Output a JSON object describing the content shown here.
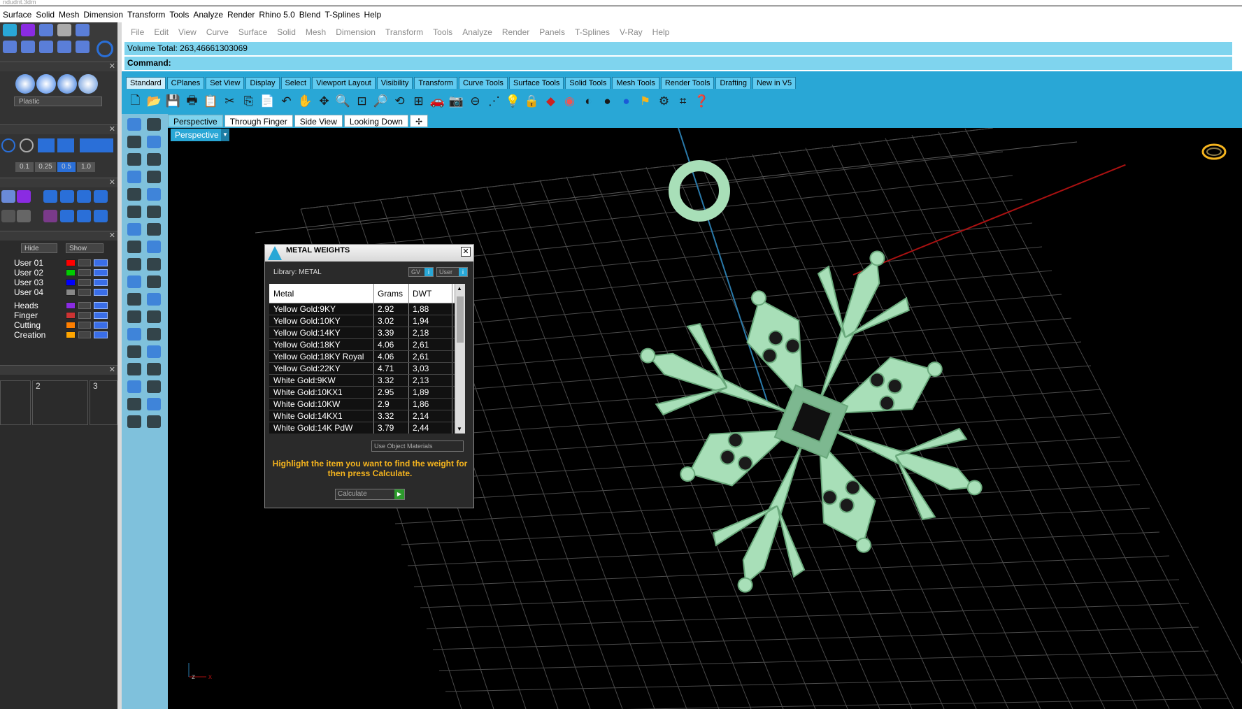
{
  "titlebar": {
    "text": "ndudnt.3dm"
  },
  "menubar": [
    "Surface",
    "Solid",
    "Mesh",
    "Dimension",
    "Transform",
    "Tools",
    "Analyze",
    "Render",
    "Rhino 5.0",
    "Blend",
    "T-Splines",
    "Help"
  ],
  "rhino_menu": [
    "File",
    "Edit",
    "View",
    "Curve",
    "Surface",
    "Solid",
    "Mesh",
    "Dimension",
    "Transform",
    "Tools",
    "Analyze",
    "Render",
    "Panels",
    "T-Splines",
    "V-Ray",
    "Help"
  ],
  "command": {
    "history": "Volume Total: 263,46661303069",
    "prompt": "Command:"
  },
  "toolbar_tabs": [
    "Standard",
    "CPlanes",
    "Set View",
    "Display",
    "Select",
    "Viewport Layout",
    "Visibility",
    "Transform",
    "Curve Tools",
    "Surface Tools",
    "Solid Tools",
    "Mesh Tools",
    "Render Tools",
    "Drafting",
    "New in V5"
  ],
  "view_tabs": [
    "Perspective",
    "Through Finger",
    "Side View",
    "Looking Down"
  ],
  "viewport": {
    "label": "Perspective"
  },
  "left_panel": {
    "material": "Plastic",
    "snaps": [
      "0.1",
      "0.25",
      "0.5",
      "1.0"
    ],
    "hide_label": "Hide",
    "show_label": "Show",
    "layers": [
      {
        "name": "User 01",
        "color": "#ff0000"
      },
      {
        "name": "User 02",
        "color": "#00cc00"
      },
      {
        "name": "User 03",
        "color": "#0000ff"
      },
      {
        "name": "User 04",
        "color": "#888888"
      },
      {
        "name": "Heads",
        "color": "#8a2be2"
      },
      {
        "name": "Finger",
        "color": "#cc3333"
      },
      {
        "name": "Cutting",
        "color": "#ff7f00"
      },
      {
        "name": "Creation",
        "color": "#ffa500"
      }
    ],
    "columns": [
      "2",
      "3"
    ]
  },
  "metal_weights": {
    "title": "METAL WEIGHTS",
    "library": "Library: METAL",
    "gv_label": "GV",
    "user_label": "User",
    "headers": [
      "Metal",
      "Grams",
      "DWT"
    ],
    "rows": [
      [
        "Yellow Gold:9KY",
        "2.92",
        "1,88"
      ],
      [
        "Yellow Gold:10KY",
        "3.02",
        "1,94"
      ],
      [
        "Yellow Gold:14KY",
        "3.39",
        "2,18"
      ],
      [
        "Yellow Gold:18KY",
        "4.06",
        "2,61"
      ],
      [
        "Yellow Gold:18KY Royal",
        "4.06",
        "2,61"
      ],
      [
        "Yellow Gold:22KY",
        "4.71",
        "3,03"
      ],
      [
        "White Gold:9KW",
        "3.32",
        "2,13"
      ],
      [
        "White Gold:10KX1",
        "2.95",
        "1,89"
      ],
      [
        "White Gold:10KW",
        "2.9",
        "1,86"
      ],
      [
        "White Gold:14KX1",
        "3.32",
        "2,14"
      ],
      [
        "White Gold:14K PdW",
        "3.79",
        "2,44"
      ]
    ],
    "use_object_materials": "Use Object Materials",
    "hint": "Highlight the item you want to find the weight for then press Calculate.",
    "calculate_label": "Calculate"
  },
  "colors": {
    "accent": "#29a7d6",
    "model": "#a8dfb8",
    "hint": "#f5b41e"
  }
}
